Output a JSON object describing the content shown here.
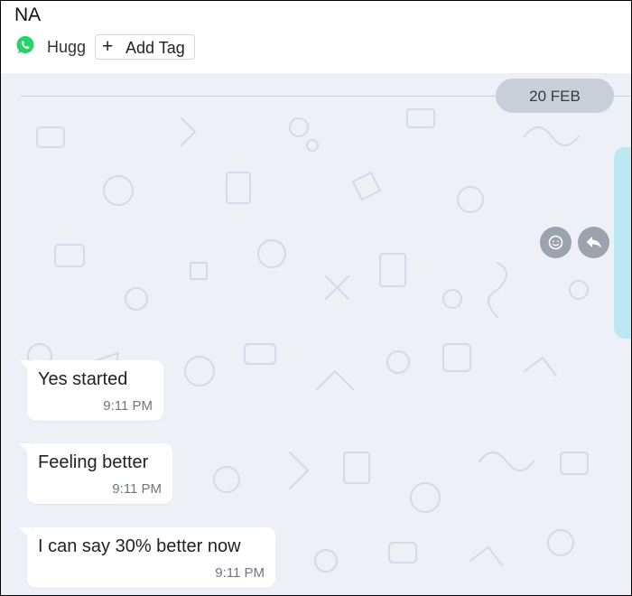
{
  "header": {
    "contact_name": "NA",
    "channel_icon": "whatsapp-icon",
    "channel_name": "Hugg",
    "add_tag_label": "Add Tag",
    "whatsapp_color": "#25D366"
  },
  "chat": {
    "date_separator": "20 FEB",
    "background_color": "#eef0f7",
    "action_icons": [
      "smiley-icon",
      "reply-icon"
    ],
    "messages": [
      {
        "direction": "incoming",
        "text": "Yes started",
        "time": "9:11 PM"
      },
      {
        "direction": "incoming",
        "text": "Feeling better",
        "time": "9:11 PM"
      },
      {
        "direction": "incoming",
        "text": "I can say 30% better now",
        "time": "9:11 PM"
      }
    ]
  }
}
